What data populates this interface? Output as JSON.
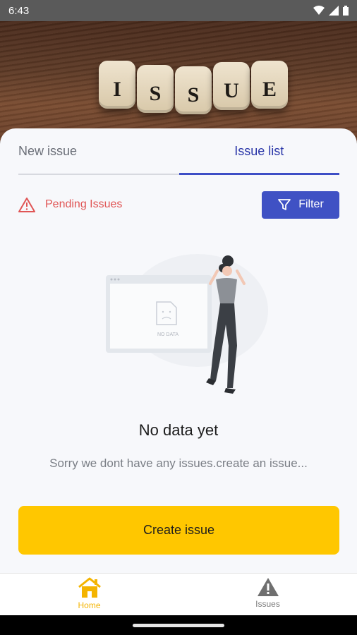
{
  "status_bar": {
    "time": "6:43"
  },
  "hero": {
    "dice_letters": [
      "I",
      "S",
      "S",
      "U",
      "E"
    ]
  },
  "tabs": [
    {
      "label": "New issue",
      "active": false
    },
    {
      "label": "Issue list",
      "active": true
    }
  ],
  "pending": {
    "label": "Pending Issues",
    "icon": "warning-triangle-icon"
  },
  "filter": {
    "label": "Filter",
    "icon": "filter-funnel-icon"
  },
  "illustration": {
    "screen_text": "NO DATA"
  },
  "empty_state": {
    "title": "No data yet",
    "subtitle": "Sorry we dont have any issues.create an issue..."
  },
  "create_button": {
    "label": "Create issue"
  },
  "bottom_nav": [
    {
      "label": "Home",
      "icon": "home-icon",
      "active": true
    },
    {
      "label": "Issues",
      "icon": "warning-icon",
      "active": false
    }
  ],
  "colors": {
    "accent_blue": "#3f51c4",
    "accent_yellow": "#ffc700",
    "warning_red": "#e05555"
  }
}
